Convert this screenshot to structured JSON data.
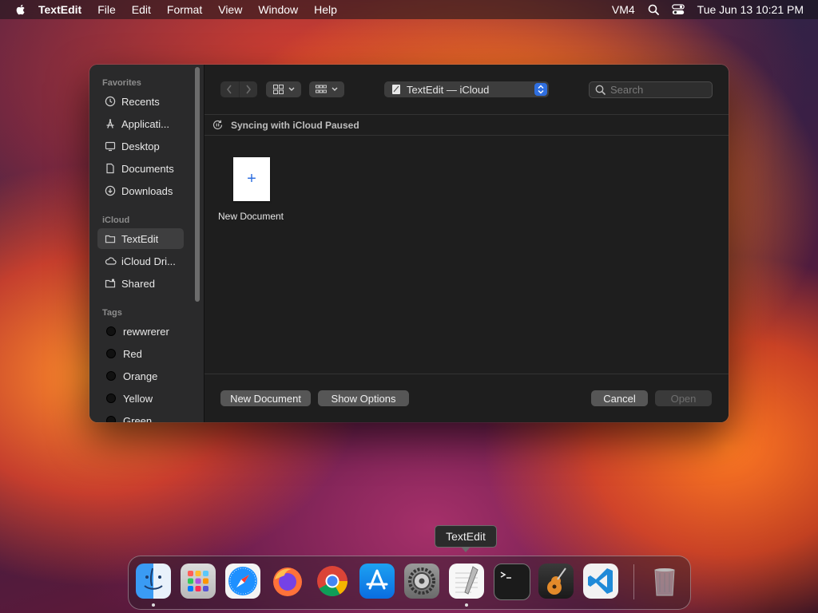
{
  "menubar": {
    "app_name": "TextEdit",
    "menus": [
      "File",
      "Edit",
      "Format",
      "View",
      "Window",
      "Help"
    ],
    "status_text": "VM4",
    "clock": "Tue Jun 13  10:21 PM"
  },
  "sidebar": {
    "favorites_title": "Favorites",
    "favorites": [
      "Recents",
      "Applicati...",
      "Desktop",
      "Documents",
      "Downloads"
    ],
    "icloud_title": "iCloud",
    "icloud": [
      "TextEdit",
      "iCloud Dri...",
      "Shared"
    ],
    "tags_title": "Tags",
    "tags": [
      "rewwrerer",
      "Red",
      "Orange",
      "Yellow",
      "Green"
    ]
  },
  "toolbar": {
    "location": "TextEdit — iCloud",
    "search_placeholder": "Search"
  },
  "sync_status": "Syncing with iCloud Paused",
  "files": {
    "new_document_caption": "New Document",
    "new_document_glyph": "+"
  },
  "footer": {
    "new_document": "New Document",
    "show_options": "Show Options",
    "cancel": "Cancel",
    "open": "Open"
  },
  "dock": {
    "tooltip": "TextEdit",
    "apps": [
      "finder-icon",
      "launchpad-icon",
      "safari-icon",
      "firefox-icon",
      "chrome-icon",
      "app-store-icon",
      "system-settings-icon",
      "textedit-icon",
      "terminal-icon",
      "garageband-icon",
      "vscode-icon",
      "trash-icon"
    ]
  },
  "colors": {
    "accent": "#2f6fe0",
    "dialog_bg": "#1e1e1e",
    "sidebar_bg": "#2a2a2b"
  }
}
